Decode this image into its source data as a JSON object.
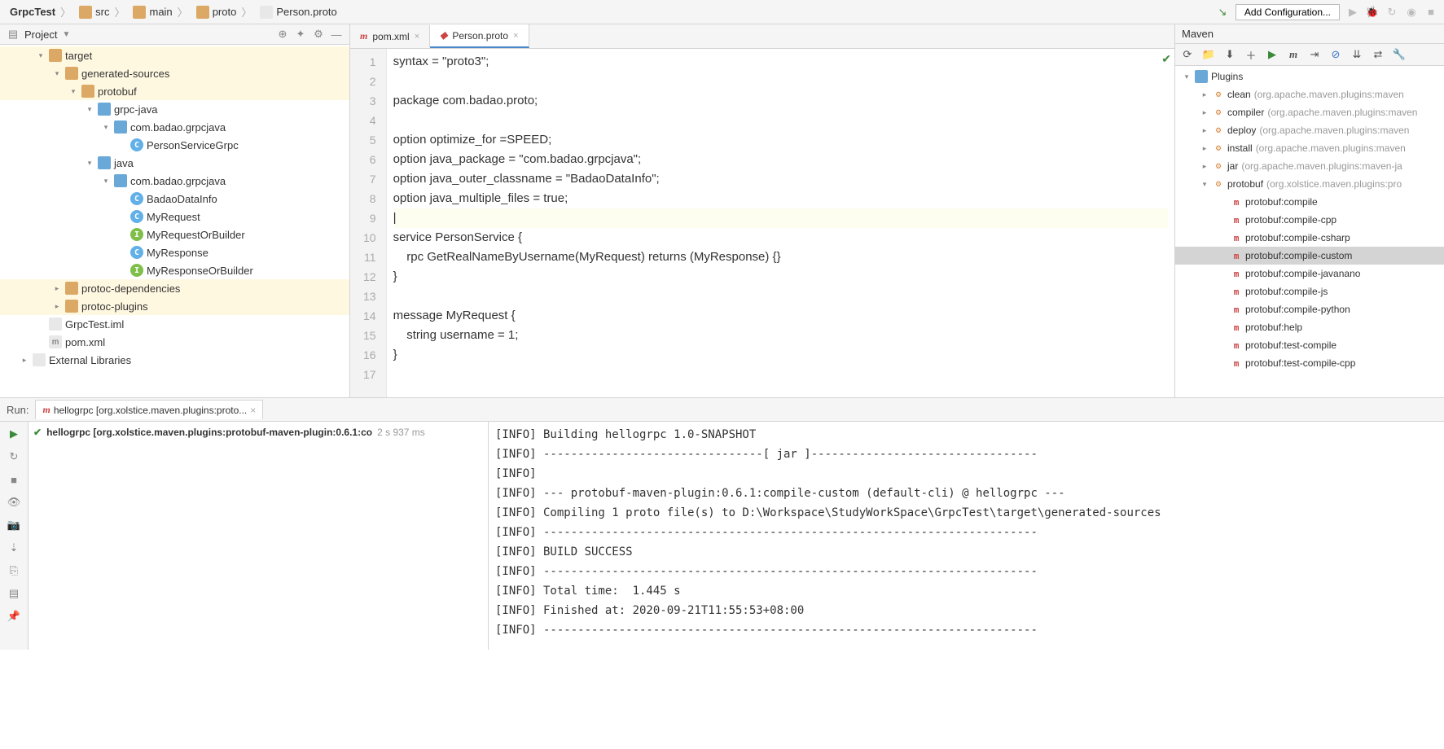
{
  "breadcrumb": [
    "GrpcTest",
    "src",
    "main",
    "proto",
    "Person.proto"
  ],
  "addConfig": "Add Configuration...",
  "projectPanel": {
    "title": "Project"
  },
  "tree": [
    {
      "indent": 0,
      "chev": "▾",
      "icon": "folder",
      "label": "target",
      "hl": true
    },
    {
      "indent": 1,
      "chev": "▾",
      "icon": "folder",
      "label": "generated-sources",
      "hl": true
    },
    {
      "indent": 2,
      "chev": "▾",
      "icon": "folder",
      "label": "protobuf",
      "hl": true
    },
    {
      "indent": 3,
      "chev": "▾",
      "icon": "folderB",
      "label": "grpc-java",
      "hl": false
    },
    {
      "indent": 4,
      "chev": "▾",
      "icon": "folderB",
      "label": "com.badao.grpcjava",
      "hl": false
    },
    {
      "indent": 5,
      "chev": "",
      "icon": "cls",
      "iconTxt": "C",
      "label": "PersonServiceGrpc",
      "hl": false
    },
    {
      "indent": 3,
      "chev": "▾",
      "icon": "folderB",
      "label": "java",
      "hl": false
    },
    {
      "indent": 4,
      "chev": "▾",
      "icon": "folderB",
      "label": "com.badao.grpcjava",
      "hl": false
    },
    {
      "indent": 5,
      "chev": "",
      "icon": "cls",
      "iconTxt": "C",
      "label": "BadaoDataInfo",
      "hl": false
    },
    {
      "indent": 5,
      "chev": "",
      "icon": "cls",
      "iconTxt": "C",
      "label": "MyRequest",
      "hl": false
    },
    {
      "indent": 5,
      "chev": "",
      "icon": "intf",
      "iconTxt": "I",
      "label": "MyRequestOrBuilder",
      "hl": false
    },
    {
      "indent": 5,
      "chev": "",
      "icon": "cls",
      "iconTxt": "C",
      "label": "MyResponse",
      "hl": false
    },
    {
      "indent": 5,
      "chev": "",
      "icon": "intf",
      "iconTxt": "I",
      "label": "MyResponseOrBuilder",
      "hl": false
    },
    {
      "indent": 1,
      "chev": "▸",
      "icon": "folder",
      "label": "protoc-dependencies",
      "hl": true
    },
    {
      "indent": 1,
      "chev": "▸",
      "icon": "folder",
      "label": "protoc-plugins",
      "hl": true
    },
    {
      "indent": 0,
      "chev": "",
      "icon": "file",
      "label": "GrpcTest.iml",
      "hl": false
    },
    {
      "indent": 0,
      "chev": "",
      "icon": "file",
      "iconTxt": "m",
      "label": "pom.xml",
      "hl": false
    },
    {
      "indent": -1,
      "chev": "▸",
      "icon": "file",
      "label": "External Libraries",
      "hl": false
    }
  ],
  "tabs": [
    {
      "label": "pom.xml",
      "active": false,
      "icon": "m"
    },
    {
      "label": "Person.proto",
      "active": true,
      "icon": "p"
    }
  ],
  "code": [
    {
      "n": 1,
      "raw": "syntax = \"proto3\";"
    },
    {
      "n": 2,
      "raw": ""
    },
    {
      "n": 3,
      "raw": "package com.badao.proto;"
    },
    {
      "n": 4,
      "raw": ""
    },
    {
      "n": 5,
      "raw": "option optimize_for =SPEED;"
    },
    {
      "n": 6,
      "raw": "option java_package = \"com.badao.grpcjava\";"
    },
    {
      "n": 7,
      "raw": "option java_outer_classname = \"BadaoDataInfo\";"
    },
    {
      "n": 8,
      "raw": "option java_multiple_files = true;"
    },
    {
      "n": 9,
      "raw": "|",
      "cur": true
    },
    {
      "n": 10,
      "raw": "service PersonService {"
    },
    {
      "n": 11,
      "raw": "    rpc GetRealNameByUsername(MyRequest) returns (MyResponse) {}"
    },
    {
      "n": 12,
      "raw": "}"
    },
    {
      "n": 13,
      "raw": ""
    },
    {
      "n": 14,
      "raw": "message MyRequest {"
    },
    {
      "n": 15,
      "raw": "    string username = 1;"
    },
    {
      "n": 16,
      "raw": "}"
    },
    {
      "n": 17,
      "raw": ""
    }
  ],
  "maven": {
    "title": "Maven",
    "items": [
      {
        "indent": 0,
        "chev": "▾",
        "icon": "folderB",
        "label": "Plugins"
      },
      {
        "indent": 1,
        "chev": "▸",
        "icon": "gear",
        "label": "clean",
        "sub": "(org.apache.maven.plugins:maven"
      },
      {
        "indent": 1,
        "chev": "▸",
        "icon": "gear",
        "label": "compiler",
        "sub": "(org.apache.maven.plugins:maven"
      },
      {
        "indent": 1,
        "chev": "▸",
        "icon": "gear",
        "label": "deploy",
        "sub": "(org.apache.maven.plugins:maven"
      },
      {
        "indent": 1,
        "chev": "▸",
        "icon": "gear",
        "label": "install",
        "sub": "(org.apache.maven.plugins:maven"
      },
      {
        "indent": 1,
        "chev": "▸",
        "icon": "gear",
        "label": "jar",
        "sub": "(org.apache.maven.plugins:maven-ja"
      },
      {
        "indent": 1,
        "chev": "▾",
        "icon": "gear",
        "label": "protobuf",
        "sub": "(org.xolstice.maven.plugins:pro"
      },
      {
        "indent": 2,
        "chev": "",
        "icon": "m",
        "label": "protobuf:compile"
      },
      {
        "indent": 2,
        "chev": "",
        "icon": "m",
        "label": "protobuf:compile-cpp"
      },
      {
        "indent": 2,
        "chev": "",
        "icon": "m",
        "label": "protobuf:compile-csharp"
      },
      {
        "indent": 2,
        "chev": "",
        "icon": "m",
        "label": "protobuf:compile-custom",
        "sel": true
      },
      {
        "indent": 2,
        "chev": "",
        "icon": "m",
        "label": "protobuf:compile-javanano"
      },
      {
        "indent": 2,
        "chev": "",
        "icon": "m",
        "label": "protobuf:compile-js"
      },
      {
        "indent": 2,
        "chev": "",
        "icon": "m",
        "label": "protobuf:compile-python"
      },
      {
        "indent": 2,
        "chev": "",
        "icon": "m",
        "label": "protobuf:help"
      },
      {
        "indent": 2,
        "chev": "",
        "icon": "m",
        "label": "protobuf:test-compile"
      },
      {
        "indent": 2,
        "chev": "",
        "icon": "m",
        "label": "protobuf:test-compile-cpp"
      }
    ]
  },
  "run": {
    "label": "Run:",
    "tab": "hellogrpc [org.xolstice.maven.plugins:proto...",
    "entry": "hellogrpc [org.xolstice.maven.plugins:protobuf-maven-plugin:0.6.1:co",
    "time": "2 s 937 ms",
    "console": [
      "[INFO] Building hellogrpc 1.0-SNAPSHOT",
      "[INFO] --------------------------------[ jar ]---------------------------------",
      "[INFO] ",
      "[INFO] --- protobuf-maven-plugin:0.6.1:compile-custom (default-cli) @ hellogrpc ---",
      "[INFO] Compiling 1 proto file(s) to D:\\Workspace\\StudyWorkSpace\\GrpcTest\\target\\generated-sources",
      "[INFO] ------------------------------------------------------------------------",
      "[INFO] BUILD SUCCESS",
      "[INFO] ------------------------------------------------------------------------",
      "[INFO] Total time:  1.445 s",
      "[INFO] Finished at: 2020-09-21T11:55:53+08:00",
      "[INFO] ------------------------------------------------------------------------"
    ]
  }
}
